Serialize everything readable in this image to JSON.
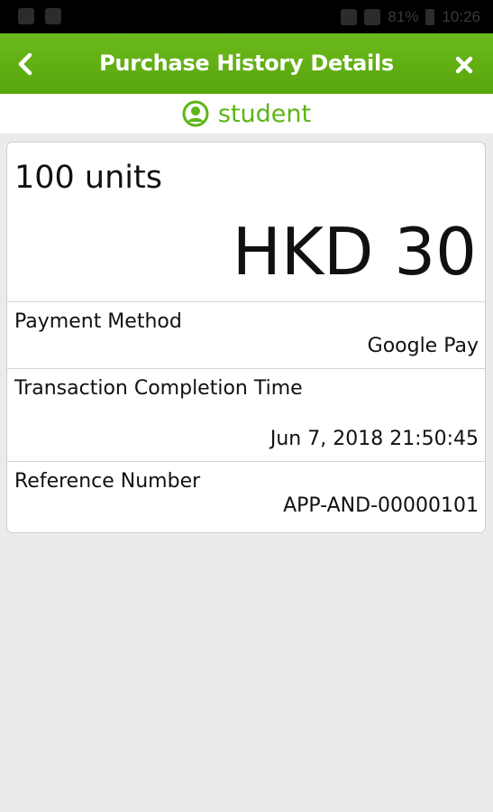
{
  "status_bar": {
    "battery_text": "81%",
    "time": "10:26"
  },
  "app_bar": {
    "title": "Purchase History Details",
    "back_icon": "chevron-left-icon",
    "close_icon": "close-icon"
  },
  "user": {
    "name": "student",
    "icon": "user-circle-icon"
  },
  "purchase": {
    "units": "100 units",
    "amount": "HKD 30"
  },
  "details": [
    {
      "label": "Payment Method",
      "value": "Google Pay"
    },
    {
      "label": "Transaction Completion Time",
      "value": "Jun 7, 2018 21:50:45"
    },
    {
      "label": "Reference Number",
      "value": "APP-AND-00000101"
    }
  ],
  "colors": {
    "accent_green": "#5db516",
    "app_bar_green": "#62af15",
    "background": "#ebebeb"
  }
}
